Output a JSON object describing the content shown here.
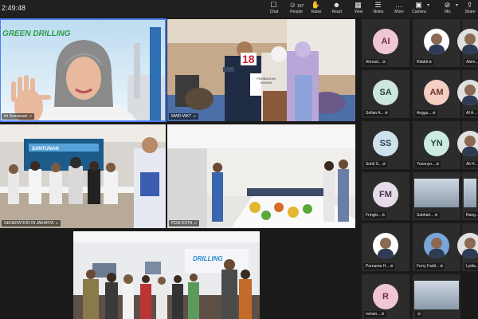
{
  "meeting_timer": "2:49:48",
  "toolbar": [
    {
      "id": "chat",
      "label": "Chat",
      "icon": "chat-icon",
      "glyph": "☐",
      "count": ""
    },
    {
      "id": "people",
      "label": "People",
      "icon": "people-icon",
      "glyph": "☺",
      "count": "167"
    },
    {
      "id": "raise",
      "label": "Raise",
      "icon": "raise-hand-icon",
      "glyph": "✋",
      "count": ""
    },
    {
      "id": "react",
      "label": "React",
      "icon": "react-icon",
      "glyph": "☻",
      "count": ""
    },
    {
      "id": "view",
      "label": "View",
      "icon": "view-icon",
      "glyph": "▦",
      "count": ""
    },
    {
      "id": "notes",
      "label": "Notes",
      "icon": "notes-icon",
      "glyph": "☰",
      "count": ""
    },
    {
      "id": "more",
      "label": "More",
      "icon": "more-icon",
      "glyph": "…",
      "count": ""
    },
    {
      "id": "camera",
      "label": "Camera",
      "icon": "camera-icon",
      "glyph": "▣",
      "count": ""
    },
    {
      "id": "mic",
      "label": "Mic",
      "icon": "mic-icon",
      "glyph": "⊘",
      "count": ""
    },
    {
      "id": "share",
      "label": "Share",
      "icon": "share-icon",
      "glyph": "⇪",
      "count": ""
    }
  ],
  "video_tiles": [
    {
      "name": "Ini Sumarsari",
      "logo_text": "GREEN DRILLING"
    },
    {
      "name": "MWD-WKT",
      "banner_text": "18",
      "sign_text": "PEMBAGIAN HADIAH"
    },
    {
      "name": "GENERATION IN JAKARTA",
      "banner_text": "SANTUNAN"
    },
    {
      "name": "PDSI KOTA",
      "banner_text": ""
    },
    {
      "name": "",
      "logo_text": "DRILLING"
    }
  ],
  "participants": [
    {
      "initials": "AI",
      "name": "Ahmad...",
      "color": "#f1c6d3",
      "text_color": "#6a2f3f",
      "photo": false
    },
    {
      "initials": "",
      "name": "Rifaldi",
      "color": "#ffffff",
      "text_color": "#333",
      "photo": true
    },
    {
      "initials": "",
      "name": "Abim...",
      "color": "#e0e0e0",
      "text_color": "#333",
      "photo": true
    },
    {
      "initials": "SA",
      "name": "Sofian A...",
      "color": "#cfe6dc",
      "text_color": "#24483a",
      "photo": false
    },
    {
      "initials": "AM",
      "name": "Anggu...",
      "color": "#f6cfc4",
      "text_color": "#6d3426",
      "photo": false
    },
    {
      "initials": "",
      "name": "Af A...",
      "color": "#e0e0e0",
      "text_color": "#333",
      "photo": true
    },
    {
      "initials": "SS",
      "name": "Suhil S...",
      "color": "#cfe2ec",
      "text_color": "#244456",
      "photo": false
    },
    {
      "initials": "YN",
      "name": "Yosanyo...",
      "color": "#cdebe2",
      "text_color": "#1f4a3e",
      "photo": false
    },
    {
      "initials": "",
      "name": "Ali H...",
      "color": "#e0e0e0",
      "text_color": "#333",
      "photo": true
    },
    {
      "initials": "FM",
      "name": "Fringki...",
      "color": "#e6dbe8",
      "text_color": "#4a2f50",
      "photo": false
    },
    {
      "initials": "",
      "name": "Subhah...",
      "color": "#e0e0e0",
      "text_color": "#333",
      "photo": true,
      "room": true
    },
    {
      "initials": "",
      "name": "Rang...",
      "color": "#e0e0e0",
      "text_color": "#333",
      "photo": true,
      "room": true
    },
    {
      "initials": "",
      "name": "Purnama H...",
      "color": "#ffffff",
      "text_color": "#333",
      "photo": true
    },
    {
      "initials": "",
      "name": "Ferry Fadil...",
      "color": "#7aa7d9",
      "text_color": "#333",
      "photo": true
    },
    {
      "initials": "",
      "name": "Lydia...",
      "color": "#e0e0e0",
      "text_color": "#333",
      "photo": true
    },
    {
      "initials": "R",
      "name": "roman...",
      "color": "#f1c6d3",
      "text_color": "#6a2f3f",
      "photo": false
    },
    {
      "initials": "",
      "name": "",
      "color": "#e0e0e0",
      "text_color": "#333",
      "photo": true,
      "room": true
    }
  ]
}
